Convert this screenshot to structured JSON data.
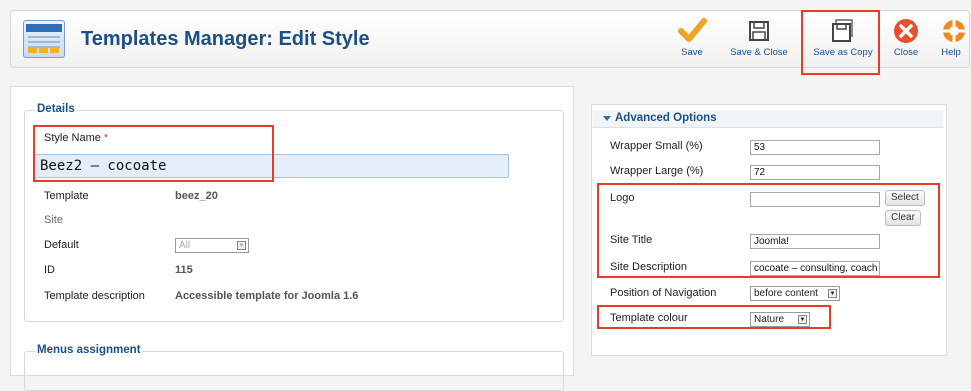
{
  "header": {
    "title": "Templates Manager: Edit Style",
    "icon": "templates-manager-icon"
  },
  "toolbar": {
    "save_label": "Save",
    "save_close_label": "Save & Close",
    "save_copy_label": "Save as Copy",
    "close_label": "Close",
    "help_label": "Help",
    "colors": {
      "save_check": "#f0a322",
      "close_red": "#e5502e",
      "help_orange": "#f08a1c",
      "highlight": "#e53d2b"
    }
  },
  "details": {
    "legend": "Details",
    "style_name_label": "Style Name",
    "required_mark": "*",
    "style_name_value": "Beez2 – cocoate",
    "template_label": "Template",
    "template_value": "beez_20",
    "client_value": "Site",
    "default_label": "Default",
    "default_value": "All",
    "id_label": "ID",
    "id_value": "115",
    "description_label": "Template description",
    "description_value": "Accessible template for Joomla 1.6"
  },
  "menus": {
    "legend": "Menus assignment"
  },
  "advanced": {
    "title": "Advanced Options",
    "wrapper_small_label": "Wrapper Small (%)",
    "wrapper_small_value": "53",
    "wrapper_large_label": "Wrapper Large (%)",
    "wrapper_large_value": "72",
    "logo_label": "Logo",
    "logo_value": "",
    "select_label": "Select",
    "clear_label": "Clear",
    "site_title_label": "Site Title",
    "site_title_value": "Joomla!",
    "site_desc_label": "Site Description",
    "site_desc_value": "cocoate – consulting, coach",
    "nav_position_label": "Position of Navigation",
    "nav_position_value": "before content",
    "template_colour_label": "Template colour",
    "template_colour_value": "Nature"
  }
}
